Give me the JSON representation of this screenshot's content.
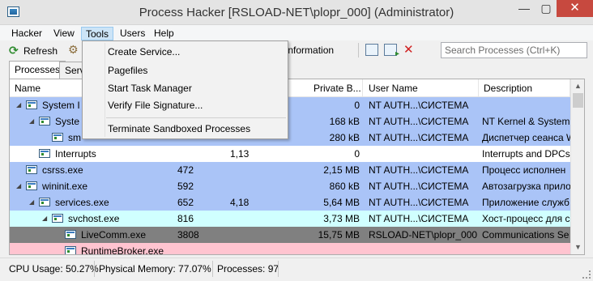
{
  "window": {
    "title": "Process Hacker [RSLOAD-NET\\plopr_000] (Administrator)",
    "minimize": "—",
    "maximize": "▢",
    "close": "✕"
  },
  "menu": [
    "Hacker",
    "View",
    "Tools",
    "Users",
    "Help"
  ],
  "toolbar": {
    "refresh": "Refresh",
    "info_partial": "n Information",
    "search_placeholder": "Search Processes (Ctrl+K)"
  },
  "tabs": {
    "processes": "Processes",
    "services_partial": "Serv"
  },
  "columns": {
    "name": "Name",
    "private": "Private B...",
    "user": "User Name",
    "description": "Description"
  },
  "processes": [
    {
      "name": "System I",
      "pid": "",
      "cpu": "",
      "private": "0",
      "user": "NT AUTH...\\СИСТЕМА",
      "desc": "",
      "level": 0,
      "expander": "◢",
      "color": "#aac4f7"
    },
    {
      "name": "Syste",
      "pid": "",
      "cpu": "",
      "private": "168 kB",
      "user": "NT AUTH...\\СИСТЕМА",
      "desc": "NT Kernel & System",
      "level": 1,
      "expander": "◢",
      "color": "#aac4f7"
    },
    {
      "name": "sm",
      "pid": "",
      "cpu": "",
      "private": "280 kB",
      "user": "NT AUTH...\\СИСТЕМА",
      "desc": "Диспетчер сеанса  W",
      "level": 2,
      "expander": "",
      "color": "#aac4f7"
    },
    {
      "name": "Interrupts",
      "pid": "",
      "cpu": "1,13",
      "private": "0",
      "user": "",
      "desc": "Interrupts and DPCs",
      "level": 1,
      "expander": "",
      "color": "#ffffff"
    },
    {
      "name": "csrss.exe",
      "pid": "472",
      "cpu": "",
      "private": "2,15 MB",
      "user": "NT AUTH...\\СИСТЕМА",
      "desc": "Процесс исполнен",
      "level": 0,
      "expander": "",
      "color": "#aac4f7"
    },
    {
      "name": "wininit.exe",
      "pid": "592",
      "cpu": "",
      "private": "860 kB",
      "user": "NT AUTH...\\СИСТЕМА",
      "desc": "Автозагрузка прило",
      "level": 0,
      "expander": "◢",
      "color": "#aac4f7"
    },
    {
      "name": "services.exe",
      "pid": "652",
      "cpu": "4,18",
      "private": "5,64 MB",
      "user": "NT AUTH...\\СИСТЕМА",
      "desc": "Приложение служб",
      "level": 1,
      "expander": "◢",
      "color": "#aac4f7"
    },
    {
      "name": "svchost.exe",
      "pid": "816",
      "cpu": "",
      "private": "3,73 MB",
      "user": "NT AUTH...\\СИСТЕМА",
      "desc": "Хост-процесс для с",
      "level": 2,
      "expander": "◢",
      "color": "#d0ffff"
    },
    {
      "name": "LiveComm.exe",
      "pid": "3808",
      "cpu": "",
      "private": "15,75 MB",
      "user": "RSLOAD-NET\\plopr_000",
      "desc": "Communications Se",
      "level": 3,
      "expander": "",
      "color": "#808080"
    },
    {
      "name": "RuntimeBroker.exe",
      "pid": "",
      "cpu": "",
      "private": "",
      "user": "",
      "desc": "",
      "level": 3,
      "expander": "",
      "color": "#ffc4d0"
    }
  ],
  "tools_menu": [
    "Create Service...",
    "Pagefiles",
    "Start Task Manager",
    "Verify File Signature...",
    "Terminate Sandboxed Processes"
  ],
  "status": {
    "cpu": "CPU Usage: 50.27%",
    "memory": "Physical Memory: 77.07%",
    "processes": "Processes: 97"
  },
  "icons": {
    "refresh": "refresh-icon",
    "options": "gear-icon",
    "close": "close-icon"
  }
}
